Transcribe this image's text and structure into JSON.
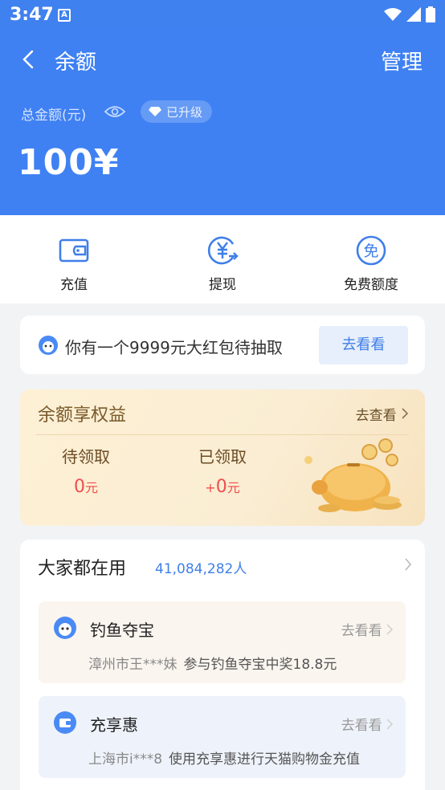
{
  "status_bar": {
    "time": "3:47"
  },
  "header": {
    "title": "余额",
    "manage_label": "管理",
    "total_label": "总金额(元)",
    "badge_label": "已升级",
    "amount": "100¥"
  },
  "actions": [
    {
      "label": "充值",
      "icon": "wallet-icon"
    },
    {
      "label": "提现",
      "icon": "yuan-withdraw-icon"
    },
    {
      "label": "免费额度",
      "icon": "free-icon"
    }
  ],
  "red_packet": {
    "text": "你有一个9999元大红包待抽取",
    "button": "去看看"
  },
  "benefit": {
    "title": "余额享权益",
    "link": "去查看",
    "pending_label": "待领取",
    "pending_value": "0",
    "claimed_label": "已领取",
    "claimed_prefix": "+",
    "claimed_value": "0",
    "unit": "元"
  },
  "popular": {
    "title": "大家都在用",
    "count": "41,084,282人",
    "items": [
      {
        "name": "钓鱼夺宝",
        "link": "去看看",
        "who": "漳州市王***妹",
        "desc": "参与钓鱼夺宝中奖18.8元",
        "bg": "#fbf5ef"
      },
      {
        "name": "充享惠",
        "link": "去看看",
        "who": "上海市i***8",
        "desc": "使用充享惠进行天猫购物金充值",
        "bg": "#eef3fb"
      }
    ]
  },
  "colors": {
    "primary": "#3f81f3",
    "accent_red": "#f04d4d",
    "link_blue": "#3f7fe8"
  }
}
